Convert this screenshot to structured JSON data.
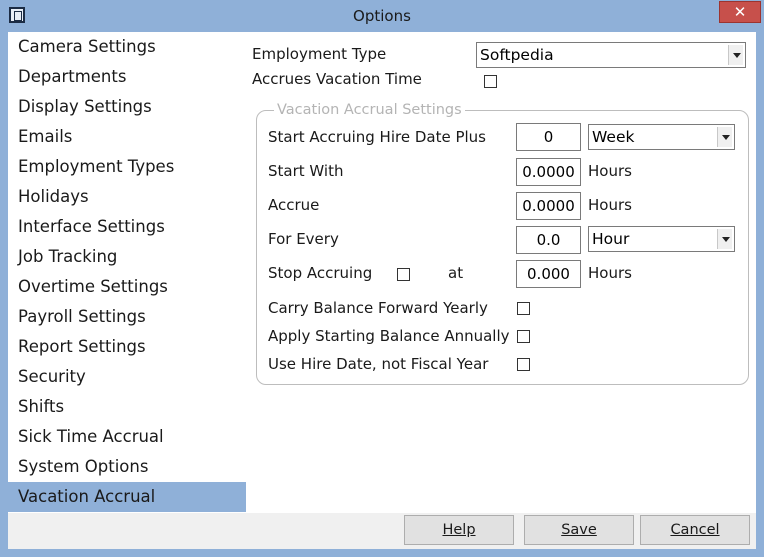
{
  "window": {
    "title": "Options",
    "close_glyph": "✕"
  },
  "sidebar": {
    "items": [
      {
        "label": "Camera Settings"
      },
      {
        "label": "Departments"
      },
      {
        "label": "Display Settings"
      },
      {
        "label": "Emails"
      },
      {
        "label": "Employment Types"
      },
      {
        "label": "Holidays"
      },
      {
        "label": "Interface Settings"
      },
      {
        "label": "Job Tracking"
      },
      {
        "label": "Overtime Settings"
      },
      {
        "label": "Payroll Settings"
      },
      {
        "label": "Report Settings"
      },
      {
        "label": "Security"
      },
      {
        "label": "Shifts"
      },
      {
        "label": "Sick Time Accrual"
      },
      {
        "label": "System Options"
      },
      {
        "label": "Vacation Accrual"
      }
    ],
    "selected": "Vacation Accrual"
  },
  "form": {
    "employment_type_label": "Employment Type",
    "employment_type_value": "Softpedia",
    "accrues_vacation_label": "Accrues Vacation Time",
    "group_title": "Vacation Accrual Settings",
    "start_accruing_label": "Start Accruing Hire Date Plus",
    "start_accruing_value": "0",
    "start_accruing_unit": "Week",
    "start_with_label": "Start With",
    "start_with_value": "0.0000",
    "start_with_unit": "Hours",
    "accrue_label": "Accrue",
    "accrue_value": "0.0000",
    "accrue_unit": "Hours",
    "for_every_label": "For Every",
    "for_every_value": "0.0",
    "for_every_unit": "Hour",
    "stop_accruing_label": "Stop Accruing",
    "stop_accruing_at_label": "at",
    "stop_accruing_value": "0.000",
    "stop_accruing_unit": "Hours",
    "carry_balance_label": "Carry Balance Forward Yearly",
    "apply_starting_label": "Apply Starting Balance Annually",
    "use_hire_date_label": "Use Hire Date, not Fiscal Year"
  },
  "footer": {
    "help_label": "Help",
    "save_label": "Save",
    "cancel_label": "Cancel"
  },
  "colors": {
    "selection": "#8fb0d8",
    "titlebar": "#8fb0d8",
    "close": "#c7504b"
  }
}
